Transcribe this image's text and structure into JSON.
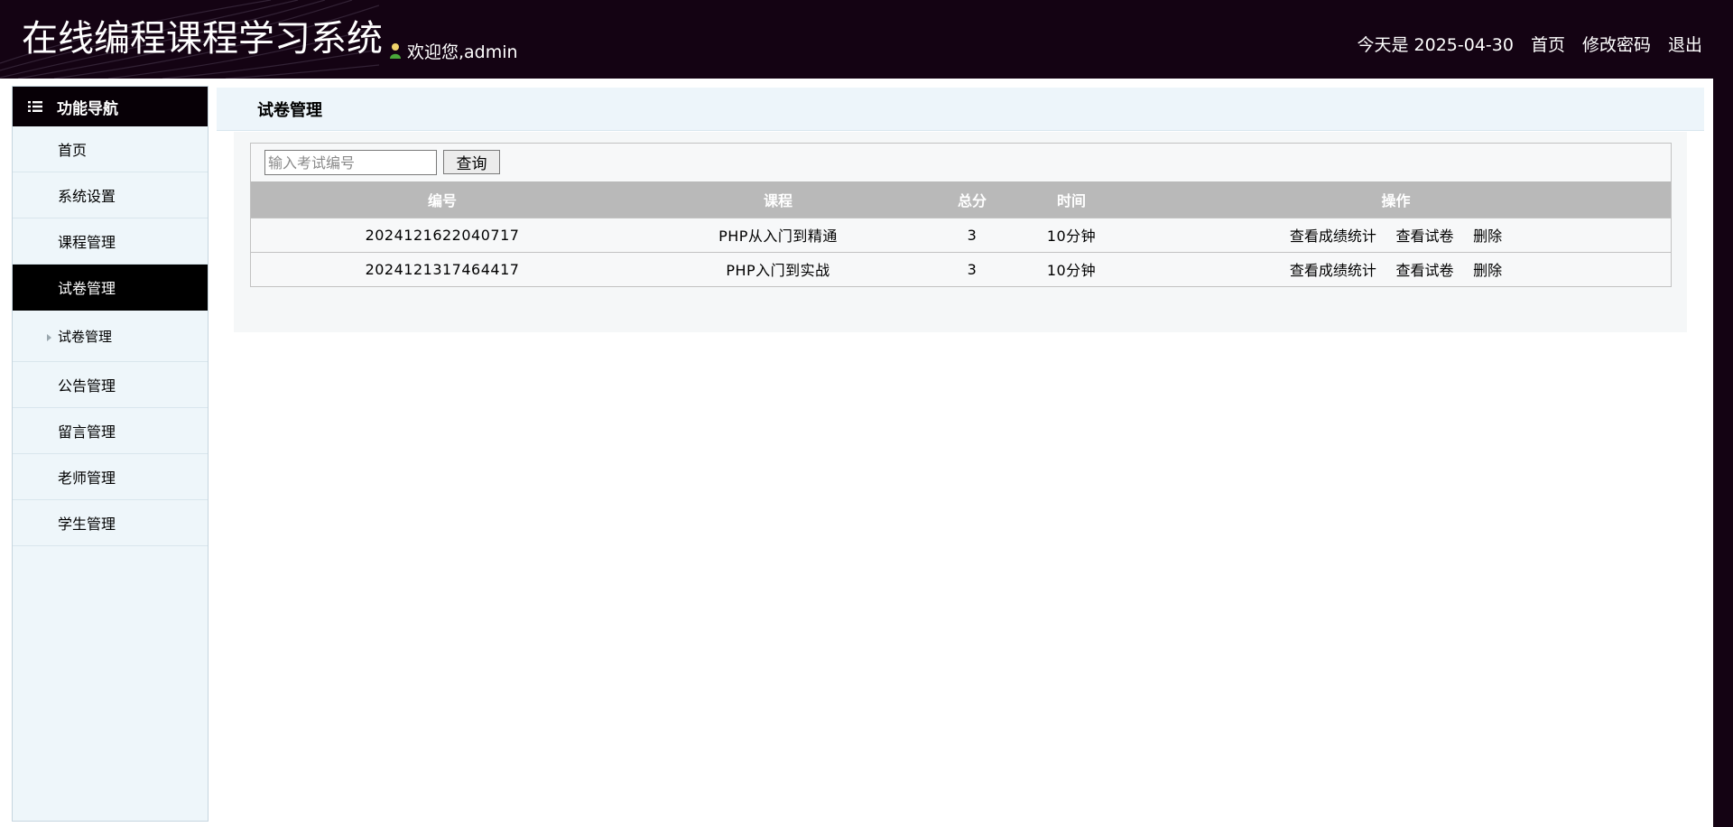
{
  "header": {
    "site_title": "在线编程课程学习系统",
    "welcome": "欢迎您,admin",
    "date_text": "今天是 2025-04-30",
    "links": [
      "首页",
      "修改密码",
      "退出"
    ]
  },
  "sidebar": {
    "heading": "功能导航",
    "items": [
      {
        "label": "首页"
      },
      {
        "label": "系统设置"
      },
      {
        "label": "课程管理"
      },
      {
        "label": "试卷管理"
      },
      {
        "label": "试卷管理"
      },
      {
        "label": "公告管理"
      },
      {
        "label": "留言管理"
      },
      {
        "label": "老师管理"
      },
      {
        "label": "学生管理"
      }
    ]
  },
  "main": {
    "title": "试卷管理",
    "search": {
      "placeholder": "输入考试编号",
      "value": "",
      "button": "查询"
    },
    "table": {
      "columns": [
        "编号",
        "课程",
        "总分",
        "时间",
        "操作"
      ],
      "rows": [
        {
          "id": "2024121622040717",
          "course": "PHP从入门到精通",
          "score": "3",
          "time": "10分钟",
          "actions": [
            "查看成绩统计",
            "查看试卷",
            "删除"
          ]
        },
        {
          "id": "2024121317464417",
          "course": "PHP入门到实战",
          "score": "3",
          "time": "10分钟",
          "actions": [
            "查看成绩统计",
            "查看试卷",
            "删除"
          ]
        }
      ]
    }
  },
  "colors": {
    "header_bg": "#140313",
    "sidebar_bg": "#eef6fa",
    "active_bg": "#000000",
    "table_head_bg": "#b9b9b9"
  }
}
